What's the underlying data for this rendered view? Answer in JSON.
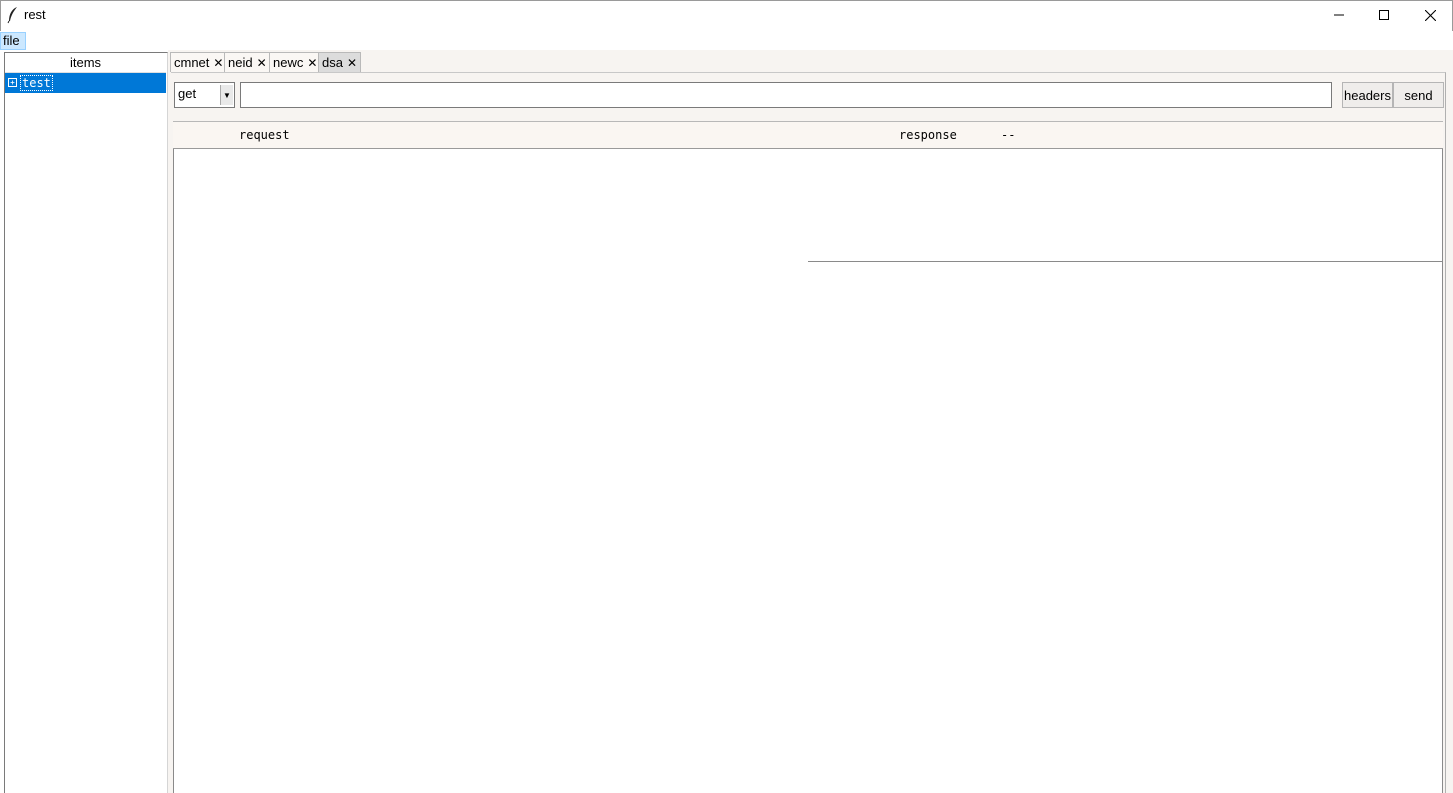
{
  "window": {
    "title": "rest",
    "icon": "feather-icon",
    "controls": [
      "minimize-icon",
      "maximize-icon",
      "close-icon"
    ]
  },
  "menu": {
    "file_label": "file"
  },
  "tree": {
    "header": "items",
    "items": [
      {
        "label": "test",
        "selected": true,
        "expander": "plus-box-icon"
      }
    ]
  },
  "tabs": [
    {
      "label": "cmnet",
      "close": "✕",
      "active": false
    },
    {
      "label": "neid",
      "close": "✕",
      "active": false
    },
    {
      "label": "newc",
      "close": "✕",
      "active": false
    },
    {
      "label": "dsa",
      "close": "✕",
      "active": true
    }
  ],
  "request": {
    "method": "get",
    "url_value": "",
    "headers_button": "headers",
    "send_button": "send"
  },
  "panels": {
    "request_label": "request",
    "response_label": "response",
    "status": "--"
  },
  "colors": {
    "selection": "#0078d7",
    "menu_highlight": "#cce8ff",
    "panel_bg": "#f7f4f1"
  }
}
